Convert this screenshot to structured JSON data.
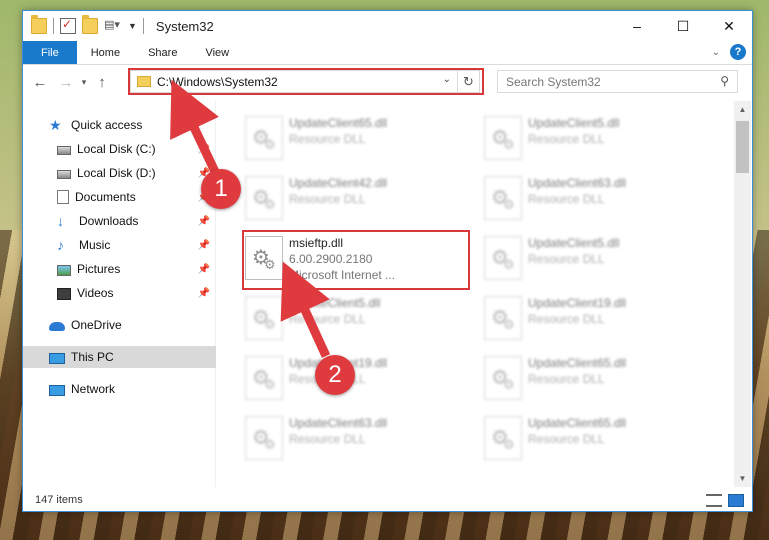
{
  "window": {
    "title": "System32",
    "controls": {
      "minimize": "–",
      "maximize": "☐",
      "close": "✕"
    }
  },
  "ribbon": {
    "tabs": [
      "File",
      "Home",
      "Share",
      "View"
    ]
  },
  "nav": {
    "address": "C:\\Windows\\System32",
    "search_placeholder": "Search System32"
  },
  "sidebar": {
    "items": [
      {
        "label": "Quick access",
        "icon": "star-icon"
      },
      {
        "label": "Local Disk (C:)",
        "icon": "drive-icon"
      },
      {
        "label": "Local Disk (D:)",
        "icon": "drive-icon"
      },
      {
        "label": "Documents",
        "icon": "documents-icon"
      },
      {
        "label": "Downloads",
        "icon": "download-icon"
      },
      {
        "label": "Music",
        "icon": "music-icon"
      },
      {
        "label": "Pictures",
        "icon": "pictures-icon"
      },
      {
        "label": "Videos",
        "icon": "videos-icon"
      },
      {
        "label": "OneDrive",
        "icon": "cloud-icon"
      },
      {
        "label": "This PC",
        "icon": "computer-icon"
      },
      {
        "label": "Network",
        "icon": "network-icon"
      }
    ]
  },
  "files": [
    {
      "name": "UpdateClient65.dll",
      "line2": "Resource DLL",
      "line3": ""
    },
    {
      "name": "UpdateClient5.dll",
      "line2": "Resource DLL",
      "line3": ""
    },
    {
      "name": "UpdateClient42.dll",
      "line2": "Resource DLL",
      "line3": ""
    },
    {
      "name": "UpdateClient63.dll",
      "line2": "Resource DLL",
      "line3": ""
    },
    {
      "name": "msieftp.dll",
      "line2": "6.00.2900.2180",
      "line3": "Microsoft Internet ..."
    },
    {
      "name": "UpdateClient5.dll",
      "line2": "Resource DLL",
      "line3": ""
    },
    {
      "name": "UpdateClient5.dll",
      "line2": "Resource DLL",
      "line3": ""
    },
    {
      "name": "UpdateClient19.dll",
      "line2": "Resource DLL",
      "line3": ""
    },
    {
      "name": "UpdateClient19.dll",
      "line2": "Resource DLL",
      "line3": ""
    },
    {
      "name": "UpdateClient65.dll",
      "line2": "Resource DLL",
      "line3": ""
    },
    {
      "name": "UpdateClient63.dll",
      "line2": "Resource DLL",
      "line3": ""
    },
    {
      "name": "UpdateClient65.dll",
      "line2": "Resource DLL",
      "line3": ""
    }
  ],
  "status": {
    "count": "147 items"
  },
  "annotations": {
    "step1": "1",
    "step2": "2",
    "highlight_color": "#d9383b"
  }
}
